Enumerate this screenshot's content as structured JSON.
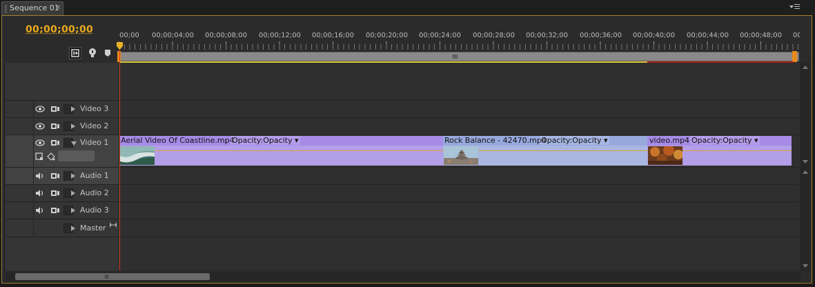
{
  "window": {
    "tab_title": "Sequence 01",
    "tab_close": "x",
    "menu_icon": "panel-menu-icon"
  },
  "toolbar": {
    "timecode": "00;00;00;00",
    "snap_icon": "snap-icon",
    "marker_icon": "add-marker-icon",
    "set_marker_icon": "set-marker-icon"
  },
  "ruler": {
    "labels": [
      "00;00",
      "00;00;04;00",
      "00;00;08;00",
      "00;00;12;00",
      "00;00;16;00",
      "00;00;20;00",
      "00;00;24;00",
      "00;00;28;00",
      "00;00;32;00",
      "00;00;36;00",
      "00;00;40;00",
      "00;00;44;00",
      "00;00;48;00",
      "00"
    ]
  },
  "tracks": {
    "video": [
      "Video 3",
      "Video 2",
      "Video 1"
    ],
    "audio": [
      "Audio 1",
      "Audio 2",
      "Audio 3"
    ],
    "master": "Master"
  },
  "clips": [
    {
      "name": "Aerial Video Of Coastline.mp4",
      "effect": "Opacity:Opacity",
      "color": "#b39ee8",
      "thumb": "coastline"
    },
    {
      "name": "Rock Balance - 42470.mp4",
      "effect": "Opacity:Opacity",
      "color": "#a9b6e0",
      "thumb": "rocks"
    },
    {
      "name": "video.mp4",
      "effect": "Opacity:Opacity",
      "color": "#b39ee8",
      "thumb": "autumn"
    }
  ],
  "colors": {
    "timecode": "#e9a91e",
    "playhead": "#d23a1e",
    "panel_border": "#a2812b",
    "work_area_handle": "#e8891b"
  }
}
